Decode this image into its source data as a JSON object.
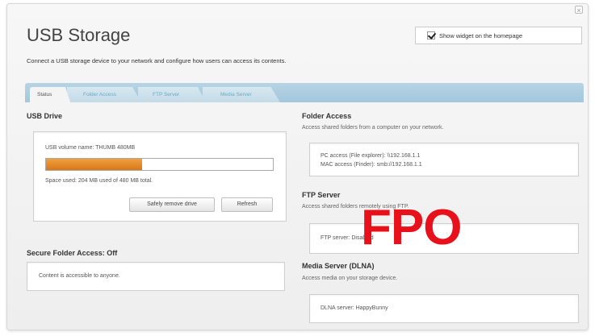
{
  "header": {
    "title": "USB Storage",
    "subtitle": "Connect a USB storage device to your network and configure how users can access its contents.",
    "widget_checkbox_label": "Show widget on the homepage",
    "widget_checked": true
  },
  "tabs": [
    {
      "label": "Status",
      "active": true
    },
    {
      "label": "Folder Access",
      "active": false
    },
    {
      "label": "FTP Server",
      "active": false
    },
    {
      "label": "Media Server",
      "active": false
    }
  ],
  "usb_drive": {
    "title": "USB Drive",
    "volume_name": "USB volume name: THUMB 480MB",
    "space_used_text": "Space used: 204 MB used of 480 MB total.",
    "used_fraction": 0.425,
    "safely_remove_label": "Safely remove drive",
    "refresh_label": "Refresh"
  },
  "secure_folder": {
    "title": "Secure Folder Access: Off",
    "text": "Content is accessible to anyone."
  },
  "folder_access": {
    "title": "Folder Access",
    "desc": "Access shared folders from a computer on your network.",
    "pc": "PC access (File explorer): \\\\192.168.1.1",
    "mac": "MAC access (Finder): smb://192.168.1.1"
  },
  "ftp_server": {
    "title": "FTP Server",
    "desc": "Access shared folders remotely using FTP.",
    "text": "FTP server: Disabled"
  },
  "media_server": {
    "title": "Media Server (DLNA)",
    "desc": "Access media on your storage device.",
    "text": "DLNA server: HappyBunny"
  },
  "overlay": {
    "text": "FPO",
    "color": "#e8101a"
  },
  "colors": {
    "progress": "#e88a2a",
    "tabbar": "#a9cbe0",
    "tab_inactive_text": "#6aa9c8"
  }
}
